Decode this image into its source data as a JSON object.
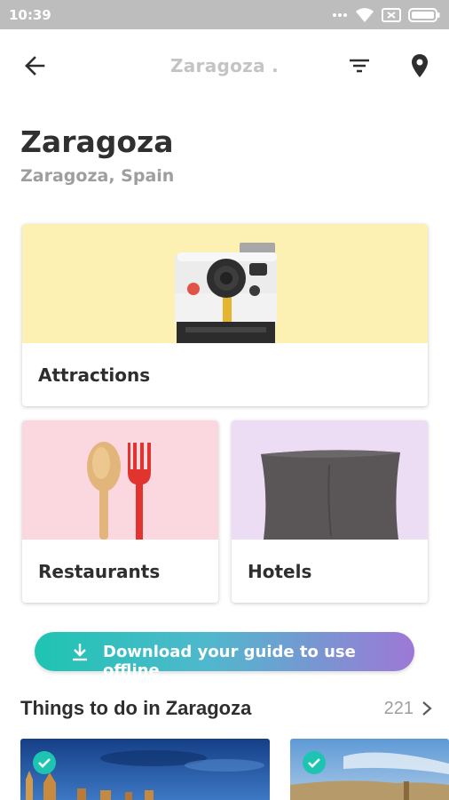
{
  "status_bar": {
    "time": "10:39",
    "icons": [
      "dots-icon",
      "wifi-icon",
      "sim-icon",
      "battery-icon"
    ]
  },
  "app_bar": {
    "title": "Zaragoza .",
    "icons": [
      "back-arrow-icon",
      "filter-icon",
      "location-pin-icon"
    ]
  },
  "header": {
    "city": "Zaragoza",
    "subtitle": "Zaragoza, Spain"
  },
  "categories": [
    {
      "label": "Attractions",
      "color": "#fdf0b3",
      "icon": "instant-camera"
    },
    {
      "label": "Restaurants",
      "color": "#fbd8df",
      "icon": "spoon-fork"
    },
    {
      "label": "Hotels",
      "color": "#ecdcf4",
      "icon": "pillow"
    }
  ],
  "download": {
    "label": "Download your guide to use offline",
    "gradient": [
      "#1ec4b2",
      "#9d78d6"
    ]
  },
  "things_to_do": {
    "title": "Things to do in Zaragoza",
    "count": "221"
  },
  "colors": {
    "accent": "#1ec4b2",
    "status_bar": "#bdbdbd"
  }
}
